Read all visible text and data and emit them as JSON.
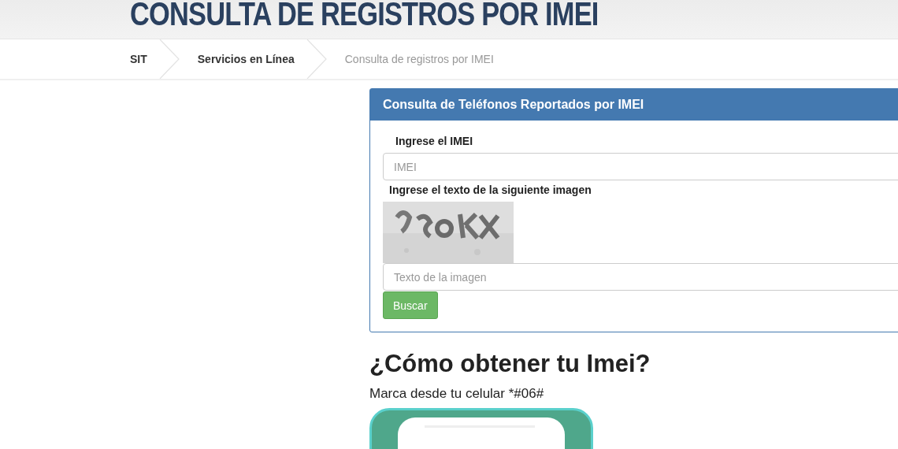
{
  "page_title": "CONSULTA DE REGISTROS POR IMEI",
  "breadcrumb": [
    {
      "label": "SIT",
      "current": false
    },
    {
      "label": "Servicios en Línea",
      "current": false
    },
    {
      "label": "Consulta de registros por IMEI",
      "current": true
    }
  ],
  "panel": {
    "title": "Consulta de Teléfonos Reportados por IMEI",
    "imei_label": "Ingrese el IMEI",
    "imei_placeholder": "IMEI",
    "captcha_label": "Ingrese el texto de la siguiente imagen",
    "captcha_placeholder": "Texto de la imagen",
    "button": "Buscar"
  },
  "help": {
    "heading": "¿Cómo obtener tu Imei?",
    "text": "Marca desde tu celular *#06#"
  }
}
